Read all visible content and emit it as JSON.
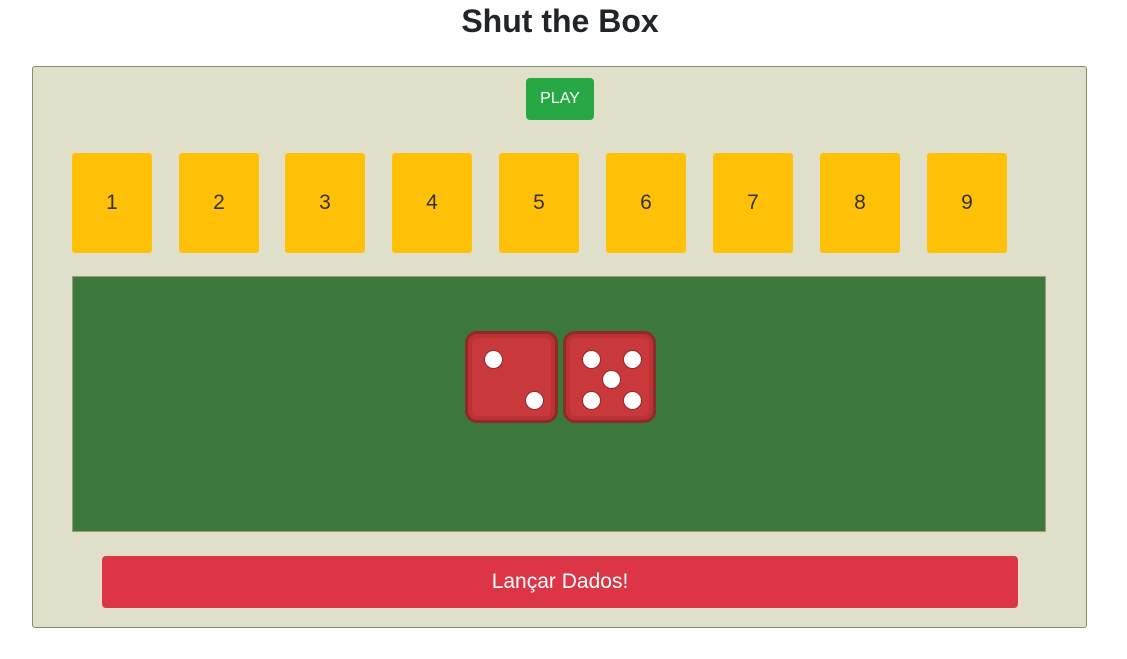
{
  "page": {
    "title": "Shut the Box"
  },
  "controls": {
    "play_label": "PLAY",
    "roll_label": "Lançar Dados!"
  },
  "tiles": [
    "1",
    "2",
    "3",
    "4",
    "5",
    "6",
    "7",
    "8",
    "9"
  ],
  "dice": [
    {
      "value": 2,
      "color": "#c9383a"
    },
    {
      "value": 5,
      "color": "#c9383a"
    }
  ],
  "colors": {
    "board": "#dfdfca",
    "tile": "#ffc107",
    "table": "#3c773c",
    "play_button": "#28a745",
    "roll_button": "#dc3545"
  }
}
